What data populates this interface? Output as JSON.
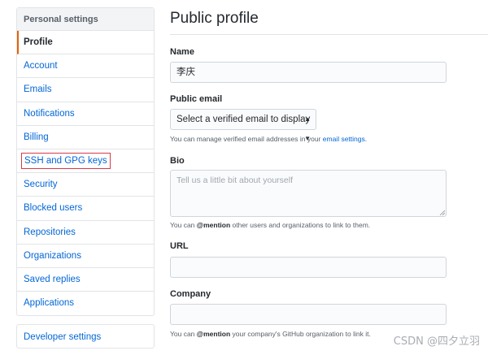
{
  "sidebar": {
    "header": "Personal settings",
    "items": [
      {
        "label": "Profile"
      },
      {
        "label": "Account"
      },
      {
        "label": "Emails"
      },
      {
        "label": "Notifications"
      },
      {
        "label": "Billing"
      },
      {
        "label": "SSH and GPG keys"
      },
      {
        "label": "Security"
      },
      {
        "label": "Blocked users"
      },
      {
        "label": "Repositories"
      },
      {
        "label": "Organizations"
      },
      {
        "label": "Saved replies"
      },
      {
        "label": "Applications"
      }
    ],
    "developer_settings": "Developer settings"
  },
  "main": {
    "title": "Public profile",
    "name": {
      "label": "Name",
      "value": "李庆"
    },
    "public_email": {
      "label": "Public email",
      "selected": "Select a verified email to display",
      "note_prefix": "You can manage verified email addresses in your",
      "note_link": "email settings",
      "note_suffix": "."
    },
    "bio": {
      "label": "Bio",
      "placeholder": "Tell us a little bit about yourself",
      "note_prefix": "You can",
      "note_mention": "@mention",
      "note_suffix": "other users and organizations to link to them."
    },
    "url": {
      "label": "URL",
      "value": ""
    },
    "company": {
      "label": "Company",
      "value": "",
      "note_prefix": "You can",
      "note_mention": "@mention",
      "note_suffix": "your company's GitHub organization to link it."
    }
  },
  "watermark": "CSDN @四夕立羽",
  "colors": {
    "link": "#0366d6",
    "active_border": "#e36209",
    "highlight_box": "#d73a49"
  }
}
